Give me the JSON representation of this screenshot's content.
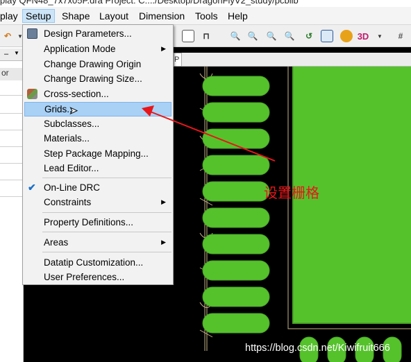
{
  "title_bar": {
    "text": "play QFN48_7x7x05P.dra  Project: C:.../Desktop/DragonFlyV2_study/pcblib"
  },
  "menubar": {
    "items": [
      "play",
      "Setup",
      "Shape",
      "Layout",
      "Dimension",
      "Tools",
      "Help"
    ],
    "active": "Setup"
  },
  "left_panel": {
    "header": "or"
  },
  "tabstrip": {
    "tab_label": "P"
  },
  "setup_menu": {
    "items": [
      {
        "label": "Design Parameters...",
        "icon": "design-parameters-icon"
      },
      {
        "label": "Application Mode",
        "submenu": true
      },
      {
        "label": "Change Drawing Origin"
      },
      {
        "label": "Change Drawing Size..."
      },
      {
        "label": "Cross-section...",
        "icon": "cross-section-icon"
      },
      {
        "label": "Grids...",
        "highlighted": true
      },
      {
        "label": "Subclasses..."
      },
      {
        "label": "Materials..."
      },
      {
        "label": "Step Package Mapping..."
      },
      {
        "label": "Lead Editor..."
      },
      {
        "label": "On-Line DRC",
        "checked": true
      },
      {
        "label": "Constraints",
        "submenu": true
      },
      {
        "label": "Property Definitions..."
      },
      {
        "label": "Areas",
        "submenu": true
      },
      {
        "label": "Datatip Customization..."
      },
      {
        "label": "User Preferences..."
      }
    ]
  },
  "annotation": {
    "text": "设置栅格",
    "color": "#e8161a"
  },
  "watermark": {
    "text": "https://blog.csdn.net/Kiwifruit666"
  },
  "colors": {
    "pad_green": "#55c22c",
    "silkscreen": "#c8b48a",
    "highlight": "#a9d1f5",
    "canvas_bg": "#000000"
  }
}
